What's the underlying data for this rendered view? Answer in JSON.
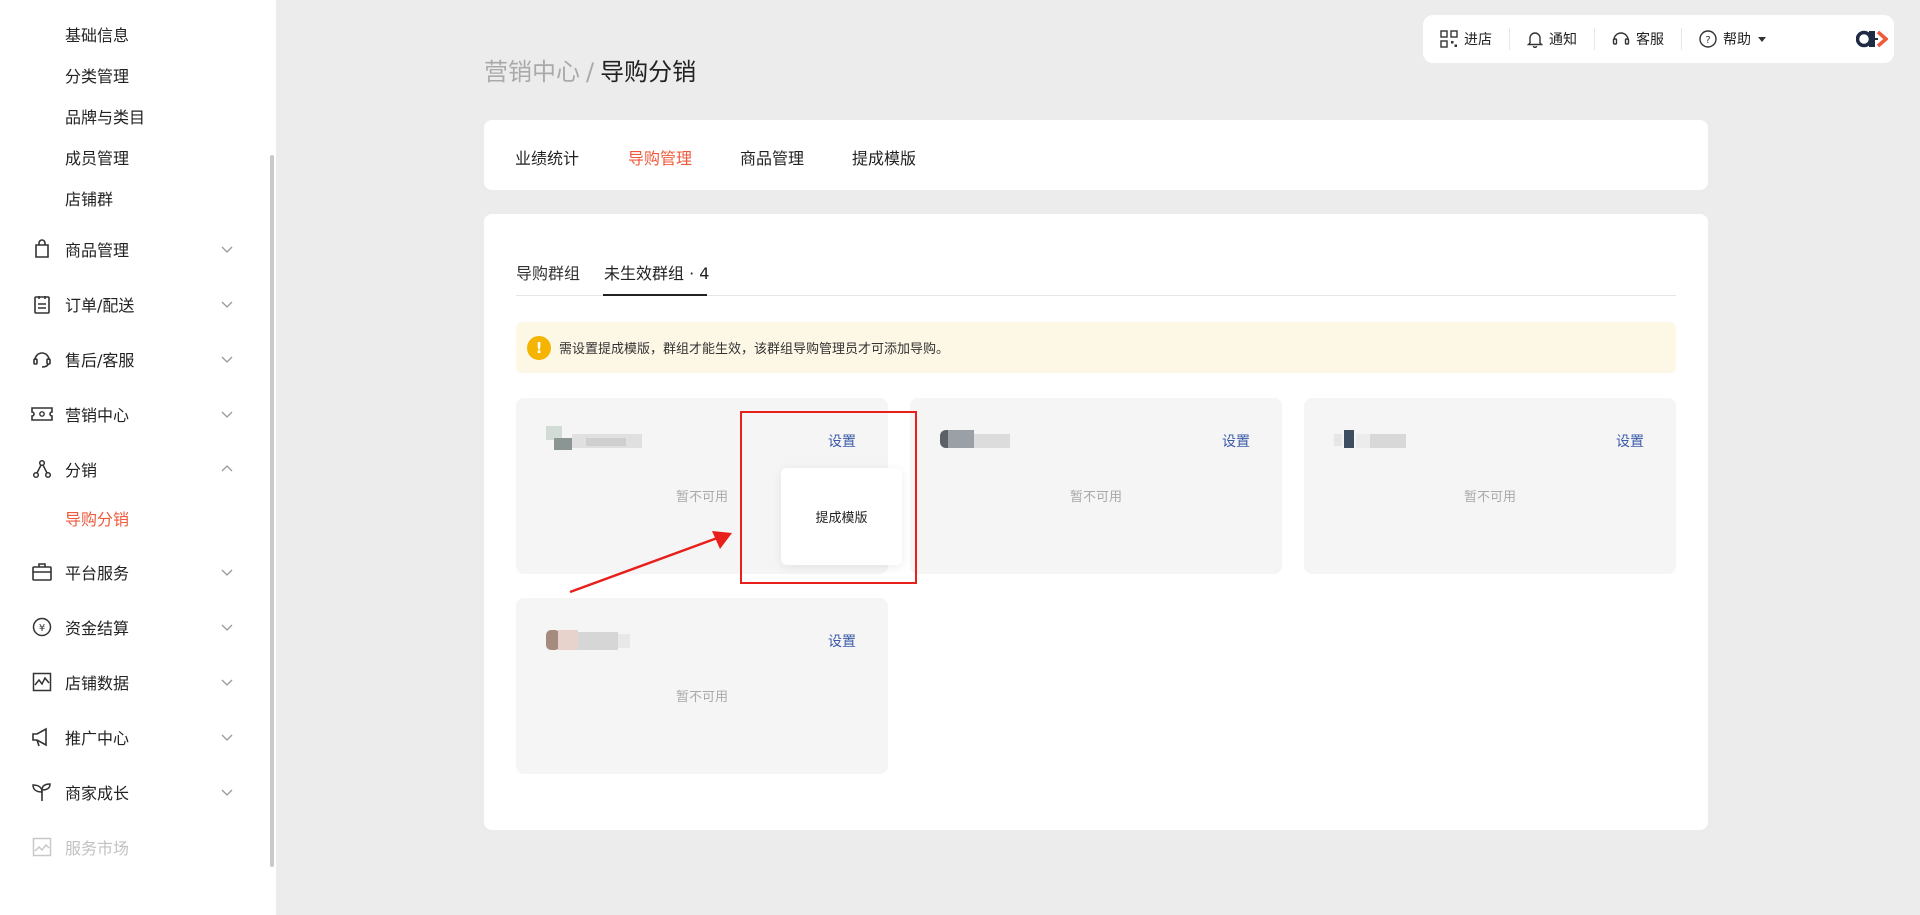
{
  "sidebar": {
    "sub_items": [
      "基础信息",
      "分类管理",
      "品牌与类目",
      "成员管理",
      "店铺群"
    ],
    "menu": [
      {
        "label": "商品管理",
        "icon": "shopping-bag-icon"
      },
      {
        "label": "订单/配送",
        "icon": "clipboard-icon"
      },
      {
        "label": "售后/客服",
        "icon": "headset-icon"
      },
      {
        "label": "营销中心",
        "icon": "ticket-icon"
      },
      {
        "label": "分销",
        "icon": "share-nodes-icon"
      },
      {
        "label": "平台服务",
        "icon": "briefcase-icon"
      },
      {
        "label": "资金结算",
        "icon": "yen-coin-icon"
      },
      {
        "label": "店铺数据",
        "icon": "chart-icon"
      },
      {
        "label": "推广中心",
        "icon": "megaphone-icon"
      },
      {
        "label": "商家成长",
        "icon": "sprout-icon"
      },
      {
        "label": "服务市场",
        "icon": "service-market-icon"
      }
    ],
    "active_sub": "导购分销"
  },
  "topbar": {
    "enter_store": "进店",
    "notify": "通知",
    "service": "客服",
    "help": "帮助"
  },
  "breadcrumb": {
    "parent": "营销中心",
    "sep": "/",
    "current": "导购分销"
  },
  "tabs": [
    "业绩统计",
    "导购管理",
    "商品管理",
    "提成模版"
  ],
  "subtabs": [
    "导购群组",
    "未生效群组 · 4"
  ],
  "notice": "需设置提成模版，群组才能生效，该群组导购管理员才可添加导购。",
  "group_cards": [
    {
      "action": "设置",
      "status": "暂不可用"
    },
    {
      "action": "设置",
      "status": "暂不可用"
    },
    {
      "action": "设置",
      "status": "暂不可用"
    },
    {
      "action": "设置",
      "status": "暂不可用"
    }
  ],
  "popup": {
    "label": "提成模版"
  },
  "colors": {
    "accent": "#f05a3c",
    "link": "#3b5ba8",
    "annotation": "#e8201c",
    "warning": "#f5b400"
  }
}
